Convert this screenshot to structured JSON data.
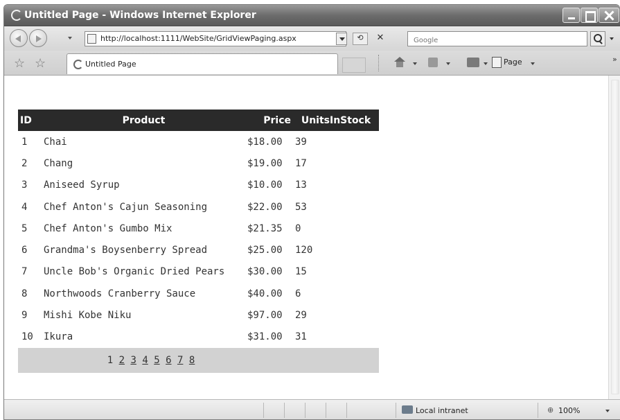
{
  "window": {
    "title": "Untitled Page - Windows Internet Explorer"
  },
  "address_bar": {
    "url": "http://localhost:1111/WebSite/GridViewPaging.aspx"
  },
  "search": {
    "placeholder": "Google"
  },
  "tab": {
    "label": "Untitled Page"
  },
  "command_bar": {
    "page_label": "Page"
  },
  "grid": {
    "headers": {
      "id": "ID",
      "product": "Product",
      "price": "Price",
      "units": "UnitsInStock"
    },
    "rows": [
      {
        "id": "1",
        "product": "Chai",
        "price": "$18.00",
        "units": "39"
      },
      {
        "id": "2",
        "product": "Chang",
        "price": "$19.00",
        "units": "17"
      },
      {
        "id": "3",
        "product": "Aniseed Syrup",
        "price": "$10.00",
        "units": "13"
      },
      {
        "id": "4",
        "product": "Chef Anton's Cajun Seasoning",
        "price": "$22.00",
        "units": "53"
      },
      {
        "id": "5",
        "product": "Chef Anton's Gumbo Mix",
        "price": "$21.35",
        "units": "0"
      },
      {
        "id": "6",
        "product": "Grandma's Boysenberry Spread",
        "price": "$25.00",
        "units": "120"
      },
      {
        "id": "7",
        "product": "Uncle Bob's Organic Dried Pears",
        "price": "$30.00",
        "units": "15"
      },
      {
        "id": "8",
        "product": "Northwoods Cranberry Sauce",
        "price": "$40.00",
        "units": "6"
      },
      {
        "id": "9",
        "product": "Mishi Kobe Niku",
        "price": "$97.00",
        "units": "29"
      },
      {
        "id": "10",
        "product": "Ikura",
        "price": "$31.00",
        "units": "31"
      }
    ],
    "pager": {
      "current": "1",
      "pages": [
        "2",
        "3",
        "4",
        "5",
        "6",
        "7",
        "8"
      ]
    }
  },
  "status": {
    "zone": "Local intranet",
    "zoom": "100%"
  },
  "colors": {
    "header_bg": "#2a2a2a",
    "pager_bg": "#d2d2d2"
  }
}
